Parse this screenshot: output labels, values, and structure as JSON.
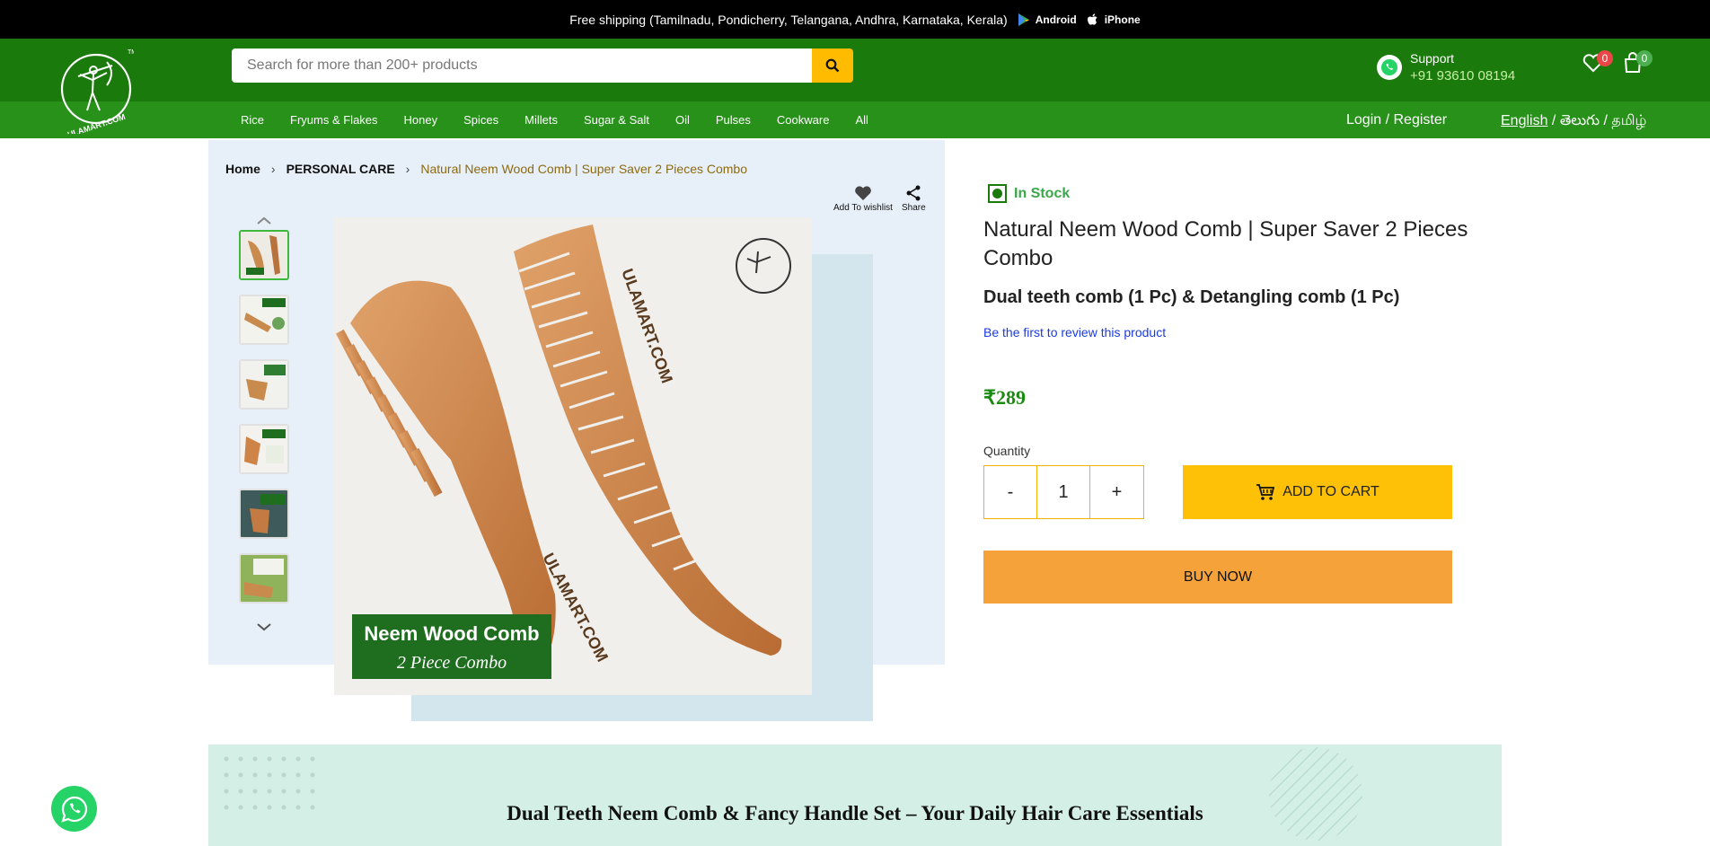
{
  "topbar": {
    "shipping_text": "Free shipping (Tamilnadu, Pondicherry, Telangana, Andhra, Karnataka, Kerala)",
    "android_label": "Android",
    "iphone_label": "iPhone"
  },
  "logo": {
    "text": "ULAMART.COM",
    "tm": "TM"
  },
  "search": {
    "placeholder": "Search for more than 200+ products"
  },
  "support": {
    "label": "Support",
    "phone": "+91 93610 08194"
  },
  "header_icons": {
    "wishlist_count": "0",
    "cart_count": "0"
  },
  "nav": {
    "items": [
      "Rice",
      "Fryums & Flakes",
      "Honey",
      "Spices",
      "Millets",
      "Sugar & Salt",
      "Oil",
      "Pulses",
      "Cookware",
      "All"
    ],
    "login": "Login / Register",
    "lang_en": "English",
    "lang_sep1": " / ",
    "lang_te": "తెలుగు",
    "lang_sep2": " / ",
    "lang_ta": "தமிழ்"
  },
  "breadcrumb": {
    "home": "Home",
    "category": "PERSONAL CARE",
    "current": "Natural Neem Wood Comb | Super Saver 2 Pieces Combo"
  },
  "actions": {
    "wishlist": "Add To wishlist",
    "share": "Share"
  },
  "main_image": {
    "caption_line1": "Neem Wood Comb",
    "caption_line2": "2 Piece Combo",
    "comb_text": "ULAMART.COM"
  },
  "product": {
    "stock": "In Stock",
    "title": "Natural Neem Wood Comb | Super Saver 2 Pieces Combo",
    "subtitle": "Dual teeth comb (1 Pc) & Detangling comb (1 Pc)",
    "review_link": "Be the first to review this product",
    "price": "₹289",
    "quantity_label": "Quantity",
    "qty_minus": "-",
    "qty_value": "1",
    "qty_plus": "+",
    "add_to_cart": "ADD TO CART",
    "buy_now": "BUY NOW"
  },
  "banner": {
    "title": "Dual Teeth Neem Comb & Fancy Handle Set – Your Daily Hair Care Essentials"
  },
  "colors": {
    "header_green": "#1a7a0b",
    "nav_green": "#27911a",
    "accent_yellow": "#ffc107",
    "buy_orange": "#f5a23a"
  }
}
